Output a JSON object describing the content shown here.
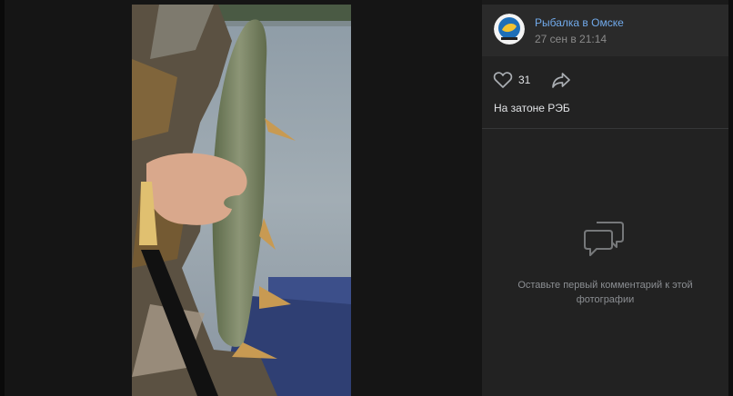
{
  "post": {
    "author": "Рыбалка в Омске",
    "date": "27 сен в 21:14",
    "likes": "31",
    "caption": "На затоне РЭБ"
  },
  "comments": {
    "empty_text": "Оставьте первый комментарий к этой фотографии"
  },
  "icons": {
    "like": "heart-icon",
    "share": "share-arrow-icon",
    "empty": "comment-bubbles-icon"
  },
  "colors": {
    "accent": "#71aaeb",
    "panel": "#222222",
    "header": "#2a2a2a"
  }
}
